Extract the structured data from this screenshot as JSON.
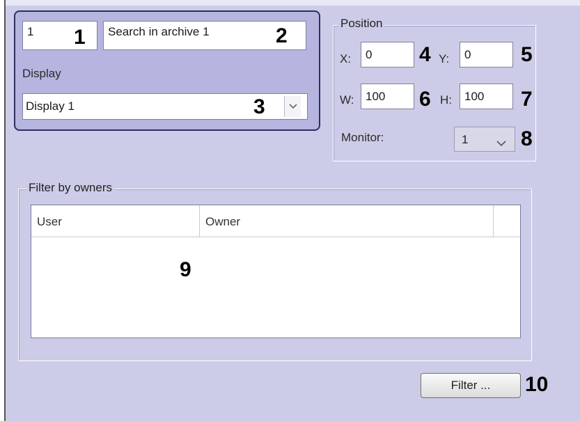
{
  "header": {
    "id_value": "1",
    "name_value": "Search in archive 1",
    "display_label": "Display",
    "display_value": "Display 1"
  },
  "position": {
    "title": "Position",
    "x_label": "X:",
    "x_value": "0",
    "y_label": "Y:",
    "y_value": "0",
    "w_label": "W:",
    "w_value": "100",
    "h_label": "H:",
    "h_value": "100",
    "monitor_label": "Monitor:",
    "monitor_value": "1"
  },
  "filter": {
    "title": "Filter by owners",
    "columns": [
      "User",
      "Owner"
    ],
    "button_label": "Filter ..."
  },
  "callouts": [
    "1",
    "2",
    "3",
    "4",
    "5",
    "6",
    "7",
    "8",
    "9",
    "10"
  ],
  "icons": {
    "dropdown": "chevron-down-icon"
  }
}
